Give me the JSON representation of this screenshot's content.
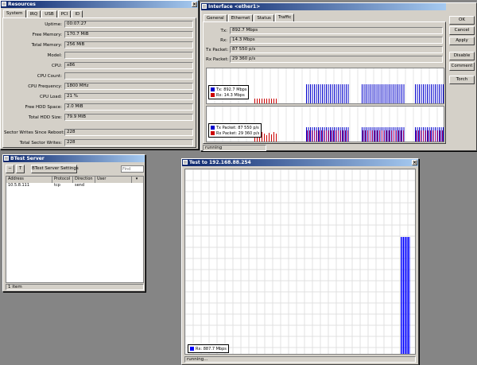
{
  "resources": {
    "title": "Resources",
    "tabs": [
      "System",
      "IRQ",
      "USB",
      "PCI",
      "ID"
    ],
    "fields": [
      {
        "label": "Uptime:",
        "value": "00:07:27"
      },
      {
        "label": "Free Memory:",
        "value": "170.7 MiB"
      },
      {
        "label": "Total Memory:",
        "value": "256 MiB"
      },
      {
        "label": "Model:",
        "value": ""
      },
      {
        "label": "CPU:",
        "value": "x86"
      },
      {
        "label": "CPU Count:",
        "value": ""
      },
      {
        "label": "CPU Frequency:",
        "value": "1800 MHz"
      },
      {
        "label": "CPU Load:",
        "value": "21 %"
      },
      {
        "label": "Free HDD Space:",
        "value": "2.0 MiB"
      },
      {
        "label": "Total HDD Size:",
        "value": "79.9 MiB"
      },
      {
        "label": "Sector Writes Since Reboot:",
        "value": "228"
      },
      {
        "label": "Total Sector Writes:",
        "value": "228"
      }
    ]
  },
  "interface": {
    "title": "Interface <ether1>",
    "tabs": [
      "General",
      "Ethernet",
      "Status",
      "Traffic"
    ],
    "fields": [
      {
        "label": "Tx:",
        "value": "892.7 Mbps"
      },
      {
        "label": "Rx:",
        "value": "14.3 Mbps"
      },
      {
        "label": "Tx Packet:",
        "value": "87 550 p/s"
      },
      {
        "label": "Rx Packet:",
        "value": "29 360 p/s"
      }
    ],
    "buttons": [
      "OK",
      "Cancel",
      "Apply",
      "Disable",
      "Comment",
      "Torch"
    ],
    "legend1": [
      {
        "label": "Tx: 892.7 Mbps",
        "color": "#0000cc"
      },
      {
        "label": "Rx: 14.3 Mbps",
        "color": "#cc0000"
      }
    ],
    "legend2": [
      {
        "label": "Tx Packet: 87 550 p/s",
        "color": "#0000cc"
      },
      {
        "label": "Rx Packet: 29 360 p/s",
        "color": "#cc0000"
      }
    ],
    "status": "running"
  },
  "btest": {
    "title": "BTest Server",
    "toolbar": {
      "settings_label": "BTest Server Settings",
      "find_placeholder": "Find"
    },
    "columns": [
      "Address",
      "Protocol",
      "Direction",
      "User"
    ],
    "rows": [
      {
        "address": "10.5.8.111",
        "protocol": "tcp",
        "direction": "send",
        "user": ""
      }
    ],
    "status": "1 item"
  },
  "test": {
    "title": "Test to 192.168.88.254",
    "legend": [
      {
        "label": "Rx: 887.7 Mbps",
        "color": "#0000ff"
      }
    ],
    "status": "running..."
  }
}
